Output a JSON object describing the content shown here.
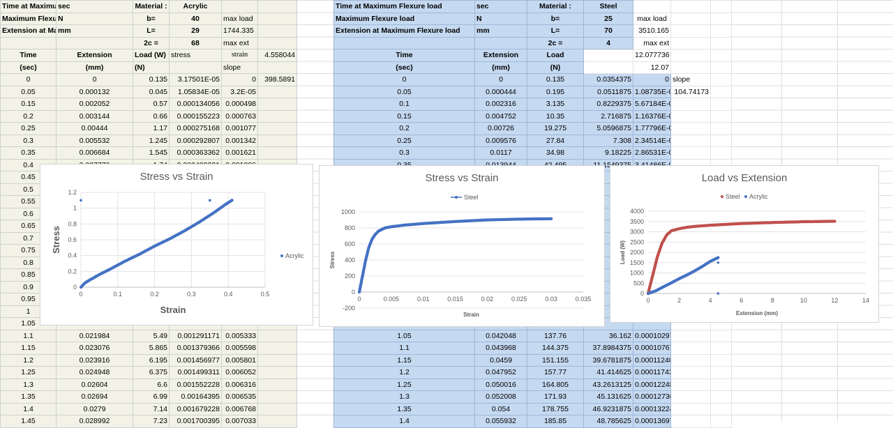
{
  "left_table": {
    "rows": [
      [
        "Time at Maximum Flexure load",
        "sec",
        "Material :",
        "Acrylic",
        "",
        ""
      ],
      [
        "Maximum Flexure load",
        "N",
        "b=",
        "40",
        "max load",
        ""
      ],
      [
        "Extension at Maximum Flexure load",
        "mm",
        "L=",
        "29",
        "1744.335",
        ""
      ],
      [
        "",
        "",
        "2c =",
        "68",
        "max ext",
        ""
      ],
      [
        "Time",
        "Extension",
        "Load (W)",
        "stress",
        "strain",
        "4.558044"
      ],
      [
        "(sec)",
        "(mm)",
        "(N)",
        "",
        "slope",
        ""
      ],
      [
        "0",
        "0",
        "0.135",
        "3.17501E-05",
        "0",
        "398.5891"
      ],
      [
        "0.05",
        "0.000132",
        "0.045",
        "1.05834E-05",
        "3.2E-05",
        ""
      ],
      [
        "0.15",
        "0.002052",
        "0.57",
        "0.000134056",
        "0.000498",
        ""
      ],
      [
        "0.2",
        "0.003144",
        "0.66",
        "0.000155223",
        "0.000763",
        ""
      ],
      [
        "0.25",
        "0.00444",
        "1.17",
        "0.000275168",
        "0.001077",
        ""
      ],
      [
        "0.3",
        "0.005532",
        "1.245",
        "0.000292807",
        "0.001342",
        ""
      ],
      [
        "0.35",
        "0.006684",
        "1.545",
        "0.000363362",
        "0.001621",
        ""
      ],
      [
        "0.4",
        "0.007776",
        "1.74",
        "0.000409221",
        "0.001886",
        ""
      ],
      [
        "0.45",
        "",
        "",
        "",
        "",
        ""
      ],
      [
        "0.5",
        "",
        "",
        "",
        "",
        ""
      ],
      [
        "0.55",
        "",
        "",
        "",
        "",
        ""
      ],
      [
        "0.6",
        "",
        "",
        "",
        "",
        ""
      ],
      [
        "0.65",
        "",
        "",
        "",
        "",
        ""
      ],
      [
        "0.7",
        "",
        "",
        "",
        "",
        ""
      ],
      [
        "0.75",
        "",
        "",
        "",
        "",
        ""
      ],
      [
        "0.8",
        "",
        "",
        "",
        "",
        ""
      ],
      [
        "0.85",
        "",
        "",
        "",
        "",
        ""
      ],
      [
        "0.9",
        "",
        "",
        "",
        "",
        ""
      ],
      [
        "0.95",
        "",
        "",
        "",
        "",
        ""
      ],
      [
        "1",
        "",
        "",
        "",
        "",
        ""
      ],
      [
        "1.05",
        "",
        "",
        "",
        "",
        ""
      ],
      [
        "1.1",
        "0.021984",
        "5.49",
        "0.001291171",
        "0.005333",
        ""
      ],
      [
        "1.15",
        "0.023076",
        "5.865",
        "0.001379366",
        "0.005598",
        ""
      ],
      [
        "1.2",
        "0.023916",
        "6.195",
        "0.001456977",
        "0.005801",
        ""
      ],
      [
        "1.25",
        "0.024948",
        "6.375",
        "0.001499311",
        "0.006052",
        ""
      ],
      [
        "1.3",
        "0.02604",
        "6.6",
        "0.001552228",
        "0.006316",
        ""
      ],
      [
        "1.35",
        "0.02694",
        "6.99",
        "0.00164395",
        "0.006535",
        ""
      ],
      [
        "1.4",
        "0.0279",
        "7.14",
        "0.001679228",
        "0.006768",
        ""
      ],
      [
        "1.45",
        "0.028992",
        "7.23",
        "0.001700395",
        "0.007033",
        ""
      ]
    ]
  },
  "right_table": {
    "rows": [
      [
        "Time at Maximum Flexure load",
        "sec",
        "Material :",
        "Steel",
        "",
        "",
        ""
      ],
      [
        "Maximum Flexure load",
        "N",
        "b=",
        "25",
        "max load",
        "",
        ""
      ],
      [
        "Extension at Maximum Flexure load",
        "mm",
        "L=",
        "70",
        "3510.165",
        "",
        ""
      ],
      [
        "",
        "",
        "2c =",
        "4",
        "max ext",
        "",
        ""
      ],
      [
        "Time",
        "Extension",
        "Load",
        "",
        "12.077736",
        "",
        ""
      ],
      [
        "(sec)",
        "(mm)",
        "(N)",
        "",
        "12.07",
        "",
        ""
      ],
      [
        "0",
        "0",
        "0.135",
        "0.0354375",
        "0",
        "slope",
        ""
      ],
      [
        "0.05",
        "0.000444",
        "0.195",
        "0.0511875",
        "1.08735E-06",
        "104.74173",
        ""
      ],
      [
        "0.1",
        "0.002316",
        "3.135",
        "0.8229375",
        "5.67184E-06",
        "",
        ""
      ],
      [
        "0.15",
        "0.004752",
        "10.35",
        "2.716875",
        "1.16376E-05",
        "",
        ""
      ],
      [
        "0.2",
        "0.00726",
        "19.275",
        "5.0596875",
        "1.77796E-05",
        "",
        ""
      ],
      [
        "0.25",
        "0.009576",
        "27.84",
        "7.308",
        "2.34514E-05",
        "",
        ""
      ],
      [
        "0.3",
        "0.0117",
        "34.98",
        "9.18225",
        "2.86531E-05",
        "",
        ""
      ],
      [
        "0.35",
        "0.013944",
        "42.495",
        "11.1549375",
        "3.41486E-05",
        "",
        ""
      ],
      [
        "",
        "",
        "",
        "",
        "",
        "",
        ""
      ],
      [
        "",
        "",
        "",
        "",
        "",
        "",
        ""
      ],
      [
        "",
        "",
        "",
        "",
        "",
        "",
        ""
      ],
      [
        "",
        "",
        "",
        "",
        "",
        "",
        ""
      ],
      [
        "",
        "",
        "",
        "",
        "",
        "",
        ""
      ],
      [
        "",
        "",
        "",
        "",
        "",
        "",
        ""
      ],
      [
        "",
        "",
        "",
        "",
        "",
        "",
        ""
      ],
      [
        "",
        "",
        "",
        "",
        "",
        "",
        ""
      ],
      [
        "",
        "",
        "",
        "",
        "",
        "",
        ""
      ],
      [
        "",
        "",
        "",
        "",
        "",
        "",
        ""
      ],
      [
        "",
        "",
        "",
        "",
        "",
        "",
        ""
      ],
      [
        "",
        "",
        "",
        "",
        "",
        "",
        ""
      ],
      [
        "",
        "",
        "",
        "",
        "",
        "",
        ""
      ],
      [
        "1.05",
        "0.042048",
        "137.76",
        "36.162",
        "0.000102975",
        "",
        ""
      ],
      [
        "1.1",
        "0.043968",
        "144.375",
        "37.8984375",
        "0.000107677",
        "",
        ""
      ],
      [
        "1.15",
        "0.0459",
        "151.155",
        "39.6781875",
        "0.000112408",
        "",
        ""
      ],
      [
        "1.2",
        "0.047952",
        "157.77",
        "41.414625",
        "0.000117433",
        "",
        ""
      ],
      [
        "1.25",
        "0.050016",
        "164.805",
        "43.2613125",
        "0.000122488",
        "",
        ""
      ],
      [
        "1.3",
        "0.052008",
        "171.93",
        "45.131625",
        "0.000127367",
        "",
        ""
      ],
      [
        "1.35",
        "0.054",
        "178.755",
        "46.9231875",
        "0.000132245",
        "",
        ""
      ],
      [
        "1.4",
        "0.055932",
        "185.85",
        "48.785625",
        "0.000136976",
        "",
        ""
      ]
    ]
  },
  "chart_data": [
    {
      "type": "scatter",
      "title": "Stress vs Strain",
      "xlabel": "Strain",
      "ylabel": "Stress",
      "xlim": [
        0,
        0.5
      ],
      "ylim": [
        0,
        1.2
      ],
      "xticks": [
        "0",
        "0.1",
        "0.2",
        "0.3",
        "0.4",
        "0.5"
      ],
      "yticks": [
        "0",
        "0.2",
        "0.4",
        "0.6",
        "0.8",
        "1",
        "1.2"
      ],
      "legend": "right",
      "series": [
        {
          "name": "Acrylic",
          "color": "#4472c4",
          "x": [
            0,
            0.01,
            0.02,
            0.05,
            0.08,
            0.12,
            0.16,
            0.2,
            0.24,
            0.28,
            0.32,
            0.36,
            0.39,
            0.41
          ],
          "y": [
            0,
            0.05,
            0.08,
            0.16,
            0.23,
            0.33,
            0.42,
            0.52,
            0.61,
            0.71,
            0.82,
            0.94,
            1.04,
            1.1
          ],
          "outliers_x": [
            0,
            0.35
          ],
          "outliers_y": [
            1.1,
            1.1
          ]
        }
      ]
    },
    {
      "type": "scatter",
      "title": "Stress vs Strain",
      "xlabel": "Strain",
      "ylabel": "Stress",
      "xlim": [
        0,
        0.035
      ],
      "ylim": [
        -200,
        1000
      ],
      "xticks": [
        "0",
        "0.005",
        "0.01",
        "0.015",
        "0.02",
        "0.025",
        "0.03",
        "0.035"
      ],
      "yticks": [
        "-200",
        "0",
        "200",
        "400",
        "600",
        "800",
        "1000"
      ],
      "legend": "top",
      "series": [
        {
          "name": "Steel",
          "color": "#4472c4",
          "x": [
            0,
            0.0005,
            0.001,
            0.0015,
            0.002,
            0.0025,
            0.003,
            0.004,
            0.005,
            0.007,
            0.01,
            0.015,
            0.02,
            0.025,
            0.03
          ],
          "y": [
            0,
            200,
            400,
            560,
            660,
            720,
            760,
            800,
            815,
            835,
            855,
            880,
            900,
            910,
            915
          ]
        }
      ]
    },
    {
      "type": "scatter",
      "title": "Load vs Extension",
      "xlabel": "Extension (mm)",
      "ylabel": "Load (W)",
      "xlim": [
        0,
        14
      ],
      "ylim": [
        0,
        4000
      ],
      "xticks": [
        "0",
        "2",
        "4",
        "6",
        "8",
        "10",
        "12",
        "14"
      ],
      "yticks": [
        "0",
        "500",
        "1000",
        "1500",
        "2000",
        "2500",
        "3000",
        "3500",
        "4000"
      ],
      "legend": "top",
      "series": [
        {
          "name": "Steel",
          "color": "#c0504d",
          "x": [
            0,
            0.3,
            0.6,
            0.9,
            1.2,
            1.5,
            2,
            2.5,
            3,
            4,
            5,
            6,
            8,
            10,
            12
          ],
          "y": [
            0,
            900,
            1800,
            2450,
            2850,
            3050,
            3150,
            3220,
            3260,
            3320,
            3360,
            3400,
            3450,
            3490,
            3510
          ]
        },
        {
          "name": "Acrylic",
          "color": "#4472c4",
          "x": [
            0,
            0.5,
            1,
            1.5,
            2,
            2.5,
            3,
            3.5,
            4,
            4.5
          ],
          "y": [
            0,
            130,
            330,
            520,
            720,
            900,
            1100,
            1320,
            1560,
            1744
          ],
          "outliers_x": [
            4.5,
            4.5
          ],
          "outliers_y": [
            0,
            1500
          ]
        }
      ]
    }
  ]
}
